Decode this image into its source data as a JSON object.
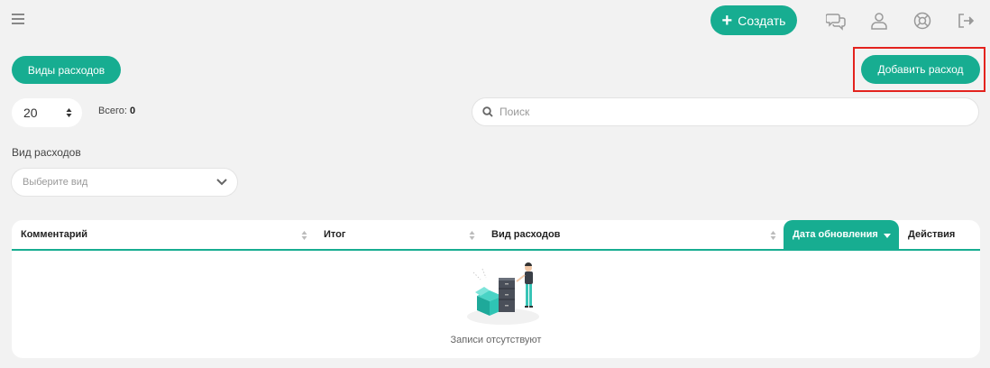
{
  "header": {
    "create_label": "Создать",
    "icons": [
      "menu-icon",
      "chat-icon",
      "user-icon",
      "lifebuoy-icon",
      "logout-icon"
    ]
  },
  "toolbar": {
    "expense_types_label": "Виды расходов",
    "add_expense_label": "Добавить расход"
  },
  "pagination": {
    "page_size": "20",
    "total_label": "Всего:",
    "total_value": "0"
  },
  "search": {
    "placeholder": "Поиск"
  },
  "filter": {
    "label": "Вид расходов",
    "placeholder": "Выберите вид"
  },
  "table": {
    "columns": [
      "Комментарий",
      "Итог",
      "Вид расходов",
      "Дата обновления",
      "Действия"
    ],
    "active_sort_column": "Дата обновления",
    "empty_text": "Записи отсутствуют"
  },
  "colors": {
    "accent": "#17ad91",
    "highlight": "#e3231e",
    "background": "#f2f2f2"
  }
}
